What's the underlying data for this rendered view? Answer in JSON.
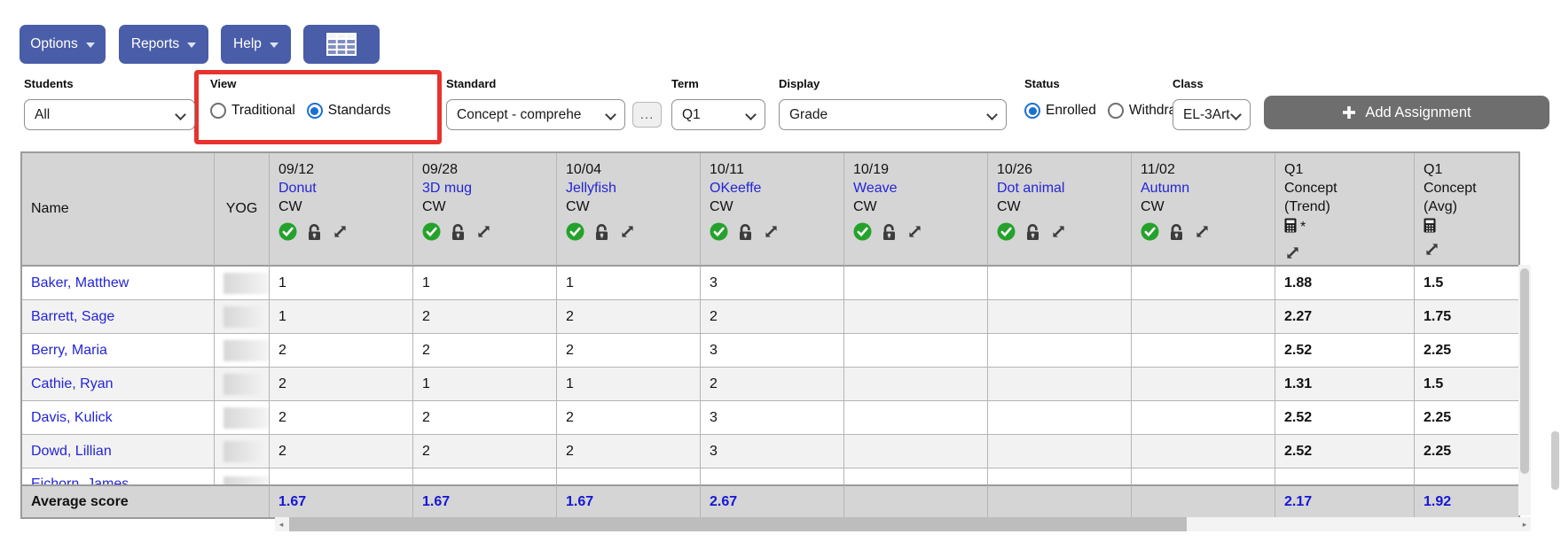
{
  "toolbar": {
    "options": "Options",
    "reports": "Reports",
    "help": "Help"
  },
  "filters": {
    "students": {
      "label": "Students",
      "value": "All"
    },
    "view": {
      "label": "View",
      "options": [
        "Traditional",
        "Standards"
      ],
      "selected": "Standards"
    },
    "standard": {
      "label": "Standard",
      "value": "Concept - comprehe",
      "more_button": "..."
    },
    "term": {
      "label": "Term",
      "value": "Q1"
    },
    "display": {
      "label": "Display",
      "value": "Grade"
    },
    "status": {
      "label": "Status",
      "options": [
        "Enrolled",
        "Withdrawn"
      ],
      "selected": "Enrolled"
    },
    "class": {
      "label": "Class",
      "value": "EL-3Art"
    },
    "add_assignment": "Add Assignment"
  },
  "table": {
    "name_header": "Name",
    "yog_header": "YOG",
    "assignments": [
      {
        "date": "09/12",
        "name": "Donut",
        "type": "CW"
      },
      {
        "date": "09/28",
        "name": "3D mug",
        "type": "CW"
      },
      {
        "date": "10/04",
        "name": "Jellyfish",
        "type": "CW"
      },
      {
        "date": "10/11",
        "name": "OKeeffe",
        "type": "CW"
      },
      {
        "date": "10/19",
        "name": "Weave",
        "type": "CW"
      },
      {
        "date": "10/26",
        "name": "Dot animal",
        "type": "CW"
      },
      {
        "date": "11/02",
        "name": "Autumn",
        "type": "CW"
      }
    ],
    "summary_columns": [
      {
        "term": "Q1",
        "standard": "Concept",
        "kind": "(Trend)",
        "asterisk": "*"
      },
      {
        "term": "Q1",
        "standard": "Concept",
        "kind": "(Avg)",
        "asterisk": ""
      }
    ],
    "rows": [
      {
        "name": "Baker, Matthew",
        "scores": [
          "1",
          "1",
          "1",
          "3",
          "",
          "",
          ""
        ],
        "trend": "1.88",
        "avg": "1.5"
      },
      {
        "name": "Barrett, Sage",
        "scores": [
          "1",
          "2",
          "2",
          "2",
          "",
          "",
          ""
        ],
        "trend": "2.27",
        "avg": "1.75"
      },
      {
        "name": "Berry, Maria",
        "scores": [
          "2",
          "2",
          "2",
          "3",
          "",
          "",
          ""
        ],
        "trend": "2.52",
        "avg": "2.25"
      },
      {
        "name": "Cathie, Ryan",
        "scores": [
          "2",
          "1",
          "1",
          "2",
          "",
          "",
          ""
        ],
        "trend": "1.31",
        "avg": "1.5"
      },
      {
        "name": "Davis, Kulick",
        "scores": [
          "2",
          "2",
          "2",
          "3",
          "",
          "",
          ""
        ],
        "trend": "2.52",
        "avg": "2.25"
      },
      {
        "name": "Dowd, Lillian",
        "scores": [
          "2",
          "2",
          "2",
          "3",
          "",
          "",
          ""
        ],
        "trend": "2.52",
        "avg": "2.25"
      },
      {
        "name": "Eichorn, James",
        "scores": [
          "",
          "",
          "",
          "",
          "",
          "",
          ""
        ],
        "trend": "",
        "avg": ""
      }
    ],
    "average": {
      "label": "Average score",
      "scores": [
        "1.67",
        "1.67",
        "1.67",
        "2.67",
        "",
        "",
        ""
      ],
      "trend": "2.17",
      "avg": "1.92"
    }
  },
  "icons": {
    "toolbar_grid": "table-grid",
    "button_caret": "caret-down",
    "select_chevron": "chevron-down",
    "assignment_status": "check-circle",
    "assignment_lock": "open-padlock",
    "assignment_expand": "diagonal-resize-arrows",
    "summary_computed": "calculator",
    "add": "plus"
  },
  "colors": {
    "button_blue": "#4a5da8",
    "highlight_red": "#e8322d",
    "link_blue": "#2424d8",
    "average_blue": "#1515d8",
    "radio_blue": "#1a6fd4",
    "header_gray": "#d5d5d5",
    "check_green": "#25a22b",
    "add_button_gray": "#6e6e6e"
  }
}
